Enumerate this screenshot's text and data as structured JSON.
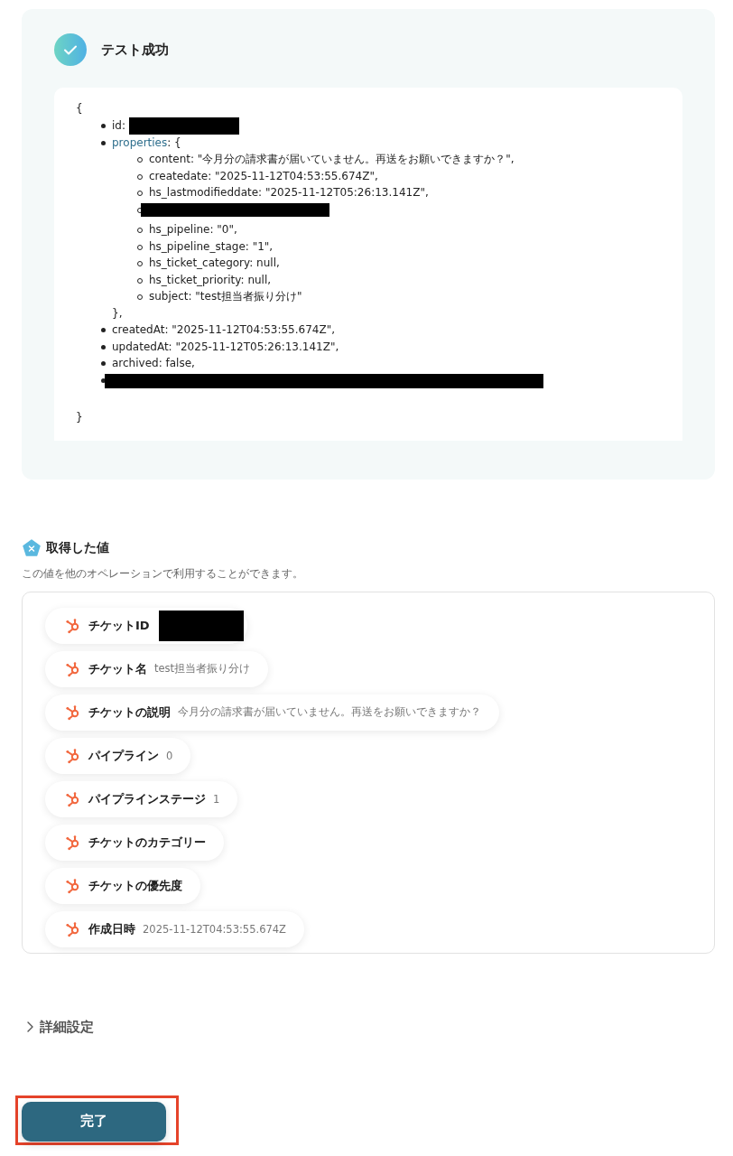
{
  "test_result": {
    "title": "テスト成功",
    "json_open": "{",
    "json_close": "}",
    "items": [
      {
        "kind": "redacted_value",
        "key": "id:"
      },
      {
        "kind": "object",
        "key": "properties",
        "suffix": ": {",
        "close": "},",
        "children": [
          {
            "kind": "text",
            "text": "content: \"今月分の請求書が届いていません。再送をお願いできますか？\","
          },
          {
            "kind": "text",
            "text": "createdate: \"2025-11-12T04:53:55.674Z\","
          },
          {
            "kind": "text",
            "text": "hs_lastmodifieddate: \"2025-11-12T05:26:13.141Z\","
          },
          {
            "kind": "redacted"
          },
          {
            "kind": "text",
            "text": "hs_pipeline: \"0\","
          },
          {
            "kind": "text",
            "text": "hs_pipeline_stage: \"1\","
          },
          {
            "kind": "text",
            "text": "hs_ticket_category: null,"
          },
          {
            "kind": "text",
            "text": "hs_ticket_priority: null,"
          },
          {
            "kind": "text",
            "text": "subject: \"test担当者振り分け\""
          }
        ]
      },
      {
        "kind": "text",
        "text": "createdAt: \"2025-11-12T04:53:55.674Z\","
      },
      {
        "kind": "text",
        "text": "updatedAt: \"2025-11-12T05:26:13.141Z\","
      },
      {
        "kind": "text",
        "text": "archived: false,"
      },
      {
        "kind": "redacted"
      }
    ]
  },
  "fetched_values": {
    "title": "取得した値",
    "description": "この値を他のオペレーションで利用することができます。",
    "chips": [
      {
        "label": "チケットID",
        "redacted": true
      },
      {
        "label": "チケット名",
        "value": "test担当者振り分け"
      },
      {
        "label": "チケットの説明",
        "value": "今月分の請求書が届いていません。再送をお願いできますか？"
      },
      {
        "label": "パイプライン",
        "value": "0"
      },
      {
        "label": "パイプラインステージ",
        "value": "1"
      },
      {
        "label": "チケットのカテゴリー"
      },
      {
        "label": "チケットの優先度"
      },
      {
        "label": "作成日時",
        "value": "2025-11-12T04:53:55.674Z"
      }
    ]
  },
  "advanced_settings": {
    "label": "詳細設定",
    "expanded": false
  },
  "done_button": {
    "label": "完了",
    "highlighted": true
  }
}
